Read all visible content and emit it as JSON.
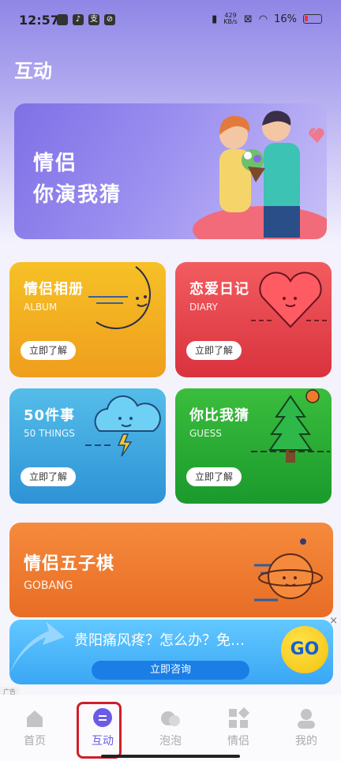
{
  "status_bar": {
    "time": "12:57",
    "speed_value": "429",
    "speed_unit": "KB/s",
    "battery": "16%"
  },
  "page": {
    "title": "互动"
  },
  "hero": {
    "line1": "情侣",
    "line2": "你演我猜"
  },
  "cards": [
    {
      "title": "情侣相册",
      "subtitle": "ALBUM",
      "button": "立即了解"
    },
    {
      "title": "恋爱日记",
      "subtitle": "DIARY",
      "button": "立即了解"
    },
    {
      "title": "50件事",
      "subtitle": "50 THINGS",
      "button": "立即了解"
    },
    {
      "title": "你比我猜",
      "subtitle": "GUESS",
      "button": "立即了解"
    },
    {
      "title": "情侣五子棋",
      "subtitle": "GOBANG"
    }
  ],
  "ad": {
    "text": "贵阳痛风疼？怎么办？免…",
    "button": "立即咨询",
    "go": "GO",
    "tag": "广告",
    "close": "×"
  },
  "nav": [
    {
      "label": "首页",
      "icon": "home-icon"
    },
    {
      "label": "互动",
      "icon": "chat-icon",
      "active": true
    },
    {
      "label": "泡泡",
      "icon": "bubbles-icon"
    },
    {
      "label": "情侣",
      "icon": "grid-icon"
    },
    {
      "label": "我的",
      "icon": "user-icon"
    }
  ]
}
